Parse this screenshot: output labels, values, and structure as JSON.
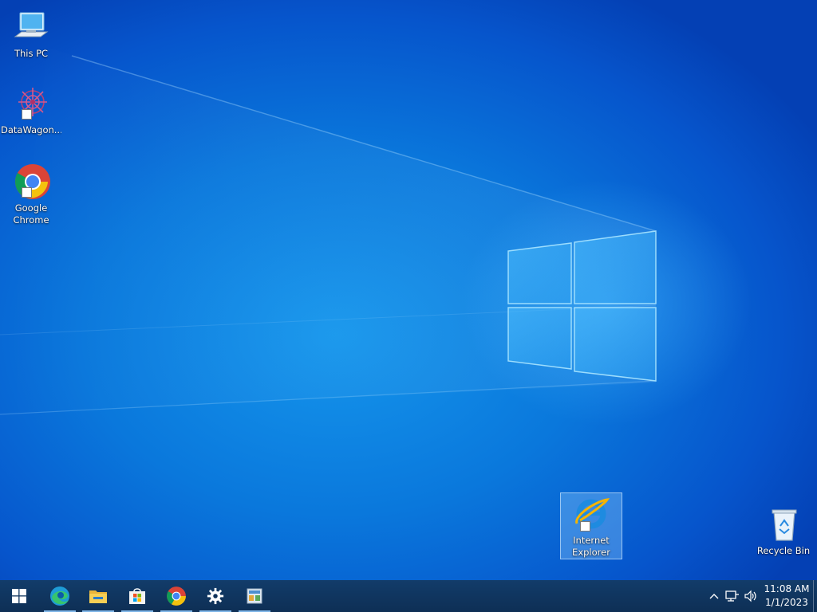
{
  "desktop": {
    "icons": [
      {
        "label": "This PC",
        "icon": "this-pc-icon"
      },
      {
        "label": "DataWagon...",
        "icon": "datawagon-icon"
      },
      {
        "label": "Google Chrome",
        "icon": "chrome-icon"
      },
      {
        "label": "Internet Explorer",
        "icon": "internet-explorer-icon"
      },
      {
        "label": "Recycle Bin",
        "icon": "recycle-bin-icon"
      }
    ]
  },
  "taskbar": {
    "pinned": [
      {
        "name": "Start",
        "icon": "windows-start-icon"
      },
      {
        "name": "Microsoft Edge",
        "icon": "edge-icon"
      },
      {
        "name": "File Explorer",
        "icon": "file-explorer-icon"
      },
      {
        "name": "Microsoft Store",
        "icon": "store-icon"
      },
      {
        "name": "Google Chrome",
        "icon": "chrome-icon"
      },
      {
        "name": "Settings",
        "icon": "gear-icon"
      },
      {
        "name": "Control Panel",
        "icon": "control-panel-icon"
      }
    ],
    "tray": {
      "icons": [
        "chevron-up-icon",
        "network-icon",
        "volume-icon"
      ],
      "time": "11:08 AM",
      "date": "1/1/2023"
    }
  },
  "colors": {
    "taskbar": "#10325a",
    "desktop": "#0a78dc",
    "accent": "#7fb6e8"
  }
}
